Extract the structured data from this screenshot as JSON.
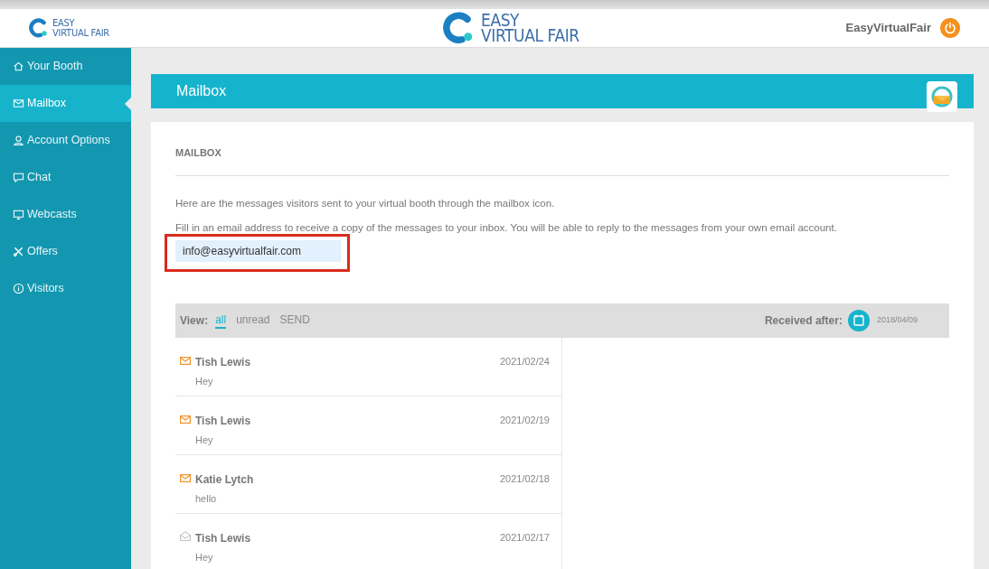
{
  "header": {
    "logo_small": [
      "EASY",
      "VIRTUAL FAIR"
    ],
    "logo_center": [
      "EASY",
      "VIRTUAL FAIR"
    ],
    "user": "EasyVirtualFair"
  },
  "sidebar": {
    "items": [
      {
        "label": "Your Booth",
        "selected": false
      },
      {
        "label": "Mailbox",
        "selected": true
      },
      {
        "label": "Account Options",
        "selected": false
      },
      {
        "label": "Chat",
        "selected": false
      },
      {
        "label": "Webcasts",
        "selected": false
      },
      {
        "label": "Offers",
        "selected": false
      },
      {
        "label": "Visitors",
        "selected": false
      }
    ]
  },
  "page_title": "Mailbox",
  "section_title": "MAILBOX",
  "intro": "Here are the messages visitors sent to your virtual booth through the mailbox icon.",
  "email_hint": "Fill in an email address to receive a copy of the messages to your inbox. You will be able to reply to the messages from your own email account.",
  "email_field": {
    "value": "info@easyvirtualfair.com",
    "highlighted": true
  },
  "filter": {
    "label": "View:",
    "tabs": [
      {
        "label": "all",
        "selected": true
      },
      {
        "label": "unread",
        "selected": false
      },
      {
        "label": "SEND",
        "selected": false
      }
    ],
    "received_label": "Received after:",
    "received_date": "2018/04/09"
  },
  "messages": [
    {
      "sender": "Tish Lewis",
      "preview": "Hey",
      "date": "2021/02/24",
      "unread": true
    },
    {
      "sender": "Tish Lewis",
      "preview": "Hey",
      "date": "2021/02/19",
      "unread": true
    },
    {
      "sender": "Katie Lytch",
      "preview": "hello",
      "date": "2021/02/18",
      "unread": true
    },
    {
      "sender": "Tish Lewis",
      "preview": "Hey",
      "date": "2021/02/17",
      "unread": false
    }
  ]
}
